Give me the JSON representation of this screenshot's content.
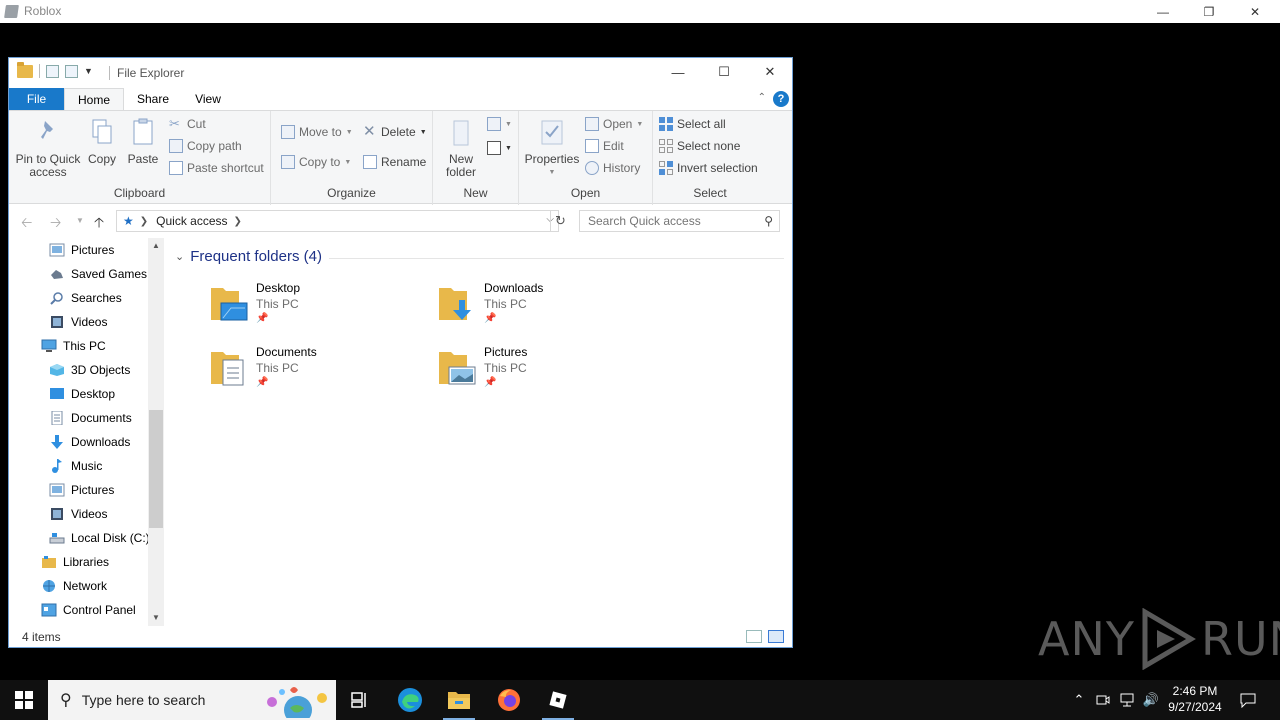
{
  "roblox": {
    "title": "Roblox"
  },
  "window": {
    "title": "File Explorer"
  },
  "tabs": [
    "File",
    "Home",
    "Share",
    "View"
  ],
  "ribbon": {
    "clipboard": {
      "label": "Clipboard",
      "pin_label_1": "Pin to Quick",
      "pin_label_2": "access",
      "copy": "Copy",
      "paste": "Paste",
      "cut": "Cut",
      "copy_path": "Copy path",
      "paste_shortcut": "Paste shortcut"
    },
    "organize": {
      "label": "Organize",
      "move_to": "Move to",
      "copy_to": "Copy to",
      "delete": "Delete",
      "rename": "Rename"
    },
    "new": {
      "label": "New",
      "new_folder_1": "New",
      "new_folder_2": "folder"
    },
    "open": {
      "label": "Open",
      "properties": "Properties",
      "open": "Open",
      "edit": "Edit",
      "history": "History"
    },
    "select": {
      "label": "Select",
      "select_all": "Select all",
      "select_none": "Select none",
      "invert_selection": "Invert selection"
    }
  },
  "address": {
    "crumb": "Quick access",
    "search_placeholder": "Search Quick access"
  },
  "nav": [
    {
      "label": "Pictures",
      "icon": "pictures-icon"
    },
    {
      "label": "Saved Games",
      "icon": "saved-games-icon"
    },
    {
      "label": "Searches",
      "icon": "search-icon"
    },
    {
      "label": "Videos",
      "icon": "videos-icon"
    },
    {
      "label": "This PC",
      "icon": "computer-icon"
    },
    {
      "label": "3D Objects",
      "icon": "3d-objects-icon"
    },
    {
      "label": "Desktop",
      "icon": "desktop-icon"
    },
    {
      "label": "Documents",
      "icon": "documents-icon"
    },
    {
      "label": "Downloads",
      "icon": "downloads-icon"
    },
    {
      "label": "Music",
      "icon": "music-icon"
    },
    {
      "label": "Pictures",
      "icon": "pictures-icon"
    },
    {
      "label": "Videos",
      "icon": "videos-icon"
    },
    {
      "label": "Local Disk (C:)",
      "icon": "disk-icon"
    },
    {
      "label": "Libraries",
      "icon": "libraries-icon"
    },
    {
      "label": "Network",
      "icon": "network-icon"
    },
    {
      "label": "Control Panel",
      "icon": "control-panel-icon"
    }
  ],
  "content": {
    "section_title": "Frequent folders (4)",
    "folders": [
      {
        "name": "Desktop",
        "location": "This PC"
      },
      {
        "name": "Downloads",
        "location": "This PC"
      },
      {
        "name": "Documents",
        "location": "This PC"
      },
      {
        "name": "Pictures",
        "location": "This PC"
      }
    ]
  },
  "status": {
    "count": "4 items"
  },
  "watermark": {
    "left": "ANY",
    "right": "RUN"
  },
  "taskbar": {
    "search_placeholder": "Type here to search",
    "time": "2:46 PM",
    "date": "9/27/2024"
  },
  "colors": {
    "accent": "#1979ca",
    "folder": "#e8b84a",
    "section_title": "#1e3287"
  }
}
